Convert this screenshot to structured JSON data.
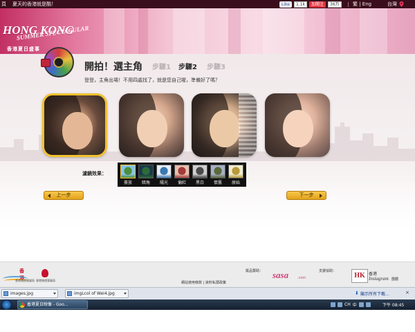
{
  "topbar": {
    "text_left": "頁",
    "text_main": "夏天的香港就是酷！",
    "like_label": "Like",
    "like_count": "1.1k",
    "weibo_label": "加關注",
    "weibo_count": "36万",
    "lang_label": "繁 | Eng",
    "region_label": "台灣",
    "pin_icon": "location-pin-icon"
  },
  "banner": {
    "logo_line1": "HONG KONG",
    "logo_line2": "SUMMER SPECTACULAR",
    "logo_cn": "香港夏日盛事"
  },
  "wizard": {
    "title": "開拍！選主角",
    "steps": [
      {
        "label": "步驟1",
        "state": "inactive"
      },
      {
        "label": "步驟2",
        "state": "active"
      },
      {
        "label": "步驟3",
        "state": "inactive"
      }
    ],
    "instruction": "登登，主角出場！不用四處找了，就是您自己喔，準備好了嗎？",
    "photos": [
      {
        "name": "photo-1",
        "selected": true
      },
      {
        "name": "photo-2",
        "selected": false
      },
      {
        "name": "photo-3",
        "selected": false
      },
      {
        "name": "photo-4",
        "selected": false
      }
    ],
    "filter_label": "濾鏡效果：",
    "filters": [
      {
        "label": "豪放",
        "color": "#4d8f3a",
        "sky": "#86c4e8"
      },
      {
        "label": "暗角",
        "color": "#2f6a3a",
        "sky": "#1a3a4a"
      },
      {
        "label": "陽光",
        "color": "#3a78b0",
        "sky": "#e8eef8"
      },
      {
        "label": "偏紅",
        "color": "#a43a3a",
        "sky": "#e8c0b0"
      },
      {
        "label": "黑白",
        "color": "#4a4a4a",
        "sky": "#d0d0d0"
      },
      {
        "label": "懷舊",
        "color": "#5a6a3a",
        "sky": "#a8b0c8"
      },
      {
        "label": "原始",
        "color": "#b89a3a",
        "sky": "#f0ecd0"
      }
    ],
    "prev_label": "上一步",
    "next_label": "下一步"
  },
  "footer": {
    "hk_cn": "香港",
    "hk_caption": "香港旅遊發展局",
    "tb_caption": "香港旅遊發展局",
    "links": "網站使用條款 | 資料私隱政策",
    "sponsor_label": "獎品贊助：",
    "sponsor_name": "sasa",
    "sponsor_suffix": ".com",
    "support_label": "支援協助：",
    "hk_box": "HK",
    "ig_line1": "香港",
    "ig_line2": "Instagram",
    "ig_line3": "團體"
  },
  "downloads": {
    "items": [
      "images.jpg",
      "imgLcol of Wei4.jpg"
    ],
    "show_all": "顯示所有下載...",
    "close": "×"
  },
  "taskbar": {
    "task_label": "香港夏日映像 - Goo...",
    "tray_lang": "CH",
    "tray_ime": "中",
    "clock": "下午 08:45"
  }
}
